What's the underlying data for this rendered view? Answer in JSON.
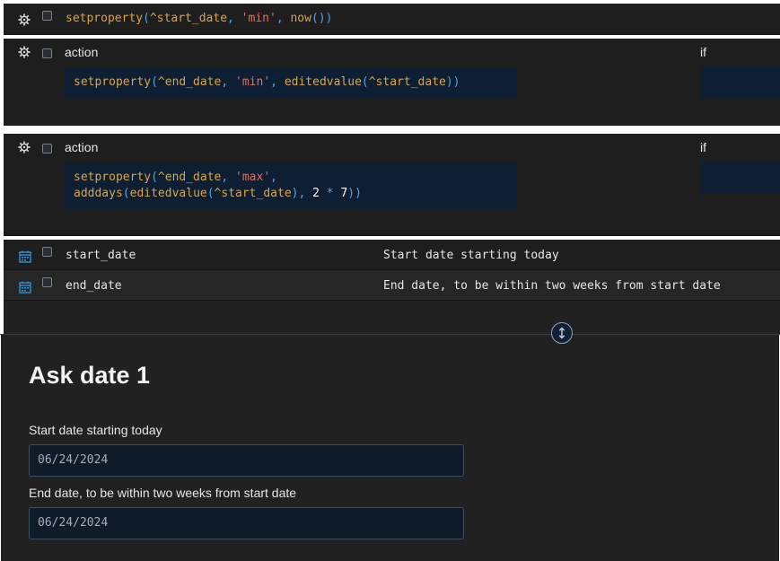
{
  "rows": {
    "r1": {
      "code": [
        {
          "t": "setproperty",
          "c": ""
        },
        {
          "t": "(",
          "c": "c-pun"
        },
        {
          "t": "^start_date",
          "c": ""
        },
        {
          "t": ", ",
          "c": "c-pun"
        },
        {
          "t": "'min'",
          "c": "c-str"
        },
        {
          "t": ", ",
          "c": "c-pun"
        },
        {
          "t": "now",
          "c": ""
        },
        {
          "t": "())",
          "c": "c-pun"
        }
      ]
    },
    "r2": {
      "label": "action",
      "if_label": "if",
      "code": [
        {
          "t": "setproperty",
          "c": ""
        },
        {
          "t": "(",
          "c": "c-pun"
        },
        {
          "t": "^end_date",
          "c": ""
        },
        {
          "t": ", ",
          "c": "c-pun"
        },
        {
          "t": "'min'",
          "c": "c-str"
        },
        {
          "t": ", ",
          "c": "c-pun"
        },
        {
          "t": "editedvalue",
          "c": ""
        },
        {
          "t": "(",
          "c": "c-pun"
        },
        {
          "t": "^start_date",
          "c": ""
        },
        {
          "t": "))",
          "c": "c-pun"
        }
      ]
    },
    "r3": {
      "label": "action",
      "if_label": "if",
      "code_line1": [
        {
          "t": "setproperty",
          "c": ""
        },
        {
          "t": "(",
          "c": "c-pun"
        },
        {
          "t": "^end_date",
          "c": ""
        },
        {
          "t": ", ",
          "c": "c-pun"
        },
        {
          "t": "'max'",
          "c": "c-str"
        },
        {
          "t": ",",
          "c": "c-pun"
        }
      ],
      "code_line2": [
        {
          "t": "adddays",
          "c": ""
        },
        {
          "t": "(",
          "c": "c-pun"
        },
        {
          "t": "editedvalue",
          "c": ""
        },
        {
          "t": "(",
          "c": "c-pun"
        },
        {
          "t": "^start_date",
          "c": ""
        },
        {
          "t": "), ",
          "c": "c-pun"
        },
        {
          "t": "2",
          "c": "c-num"
        },
        {
          "t": " * ",
          "c": "c-op"
        },
        {
          "t": "7",
          "c": "c-num"
        },
        {
          "t": "))",
          "c": "c-pun"
        }
      ]
    },
    "fields": [
      {
        "name": "start_date",
        "description": "Start date starting today",
        "icon": "calendar-icon"
      },
      {
        "name": "end_date",
        "description": "End date, to be within two weeks from start date",
        "icon": "calendar-icon"
      }
    ]
  },
  "preview": {
    "title": "Ask date 1",
    "start_label": "Start date starting today",
    "start_value": "06/24/2024",
    "end_label": "End date, to be within two weeks from start date",
    "end_value": "06/24/2024"
  },
  "icons": {
    "gear": "gear-icon",
    "calendar": "calendar-icon",
    "splitter": "resize-vertical-icon"
  },
  "colors": {
    "accent": "#2f8fd8",
    "keyword": "#d9a54b",
    "string": "#e0705f",
    "code_bg": "#0e1e33"
  }
}
